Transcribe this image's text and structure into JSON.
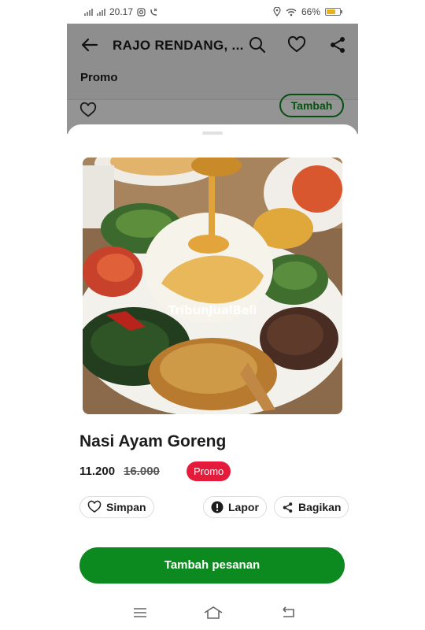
{
  "status_bar": {
    "time": "20.17",
    "battery": "66%",
    "battery_level": 0.66
  },
  "app_bar": {
    "title": "RAJO RENDANG, ...",
    "back_icon": "arrow-left-icon",
    "search_icon": "search-icon",
    "favorite_icon": "heart-icon",
    "share_icon": "share-icon"
  },
  "section": {
    "tab_label": "Promo",
    "behind_button_label": "Tambah"
  },
  "item": {
    "photo_watermark": "TribunJualBeli",
    "name": "Nasi Ayam Goreng",
    "price": "11.200",
    "original_price": "16.000",
    "badge": "Promo"
  },
  "actions": {
    "save_label": "Simpan",
    "report_label": "Lapor",
    "share_label": "Bagikan"
  },
  "cta": {
    "label": "Tambah pesanan"
  },
  "nav_bar": {
    "icons": [
      "menu-icon",
      "home-icon",
      "back-icon"
    ]
  },
  "colors": {
    "primary_green": "#0c8a1f",
    "promo_red": "#e51b3c",
    "battery": "#e8b21a"
  }
}
